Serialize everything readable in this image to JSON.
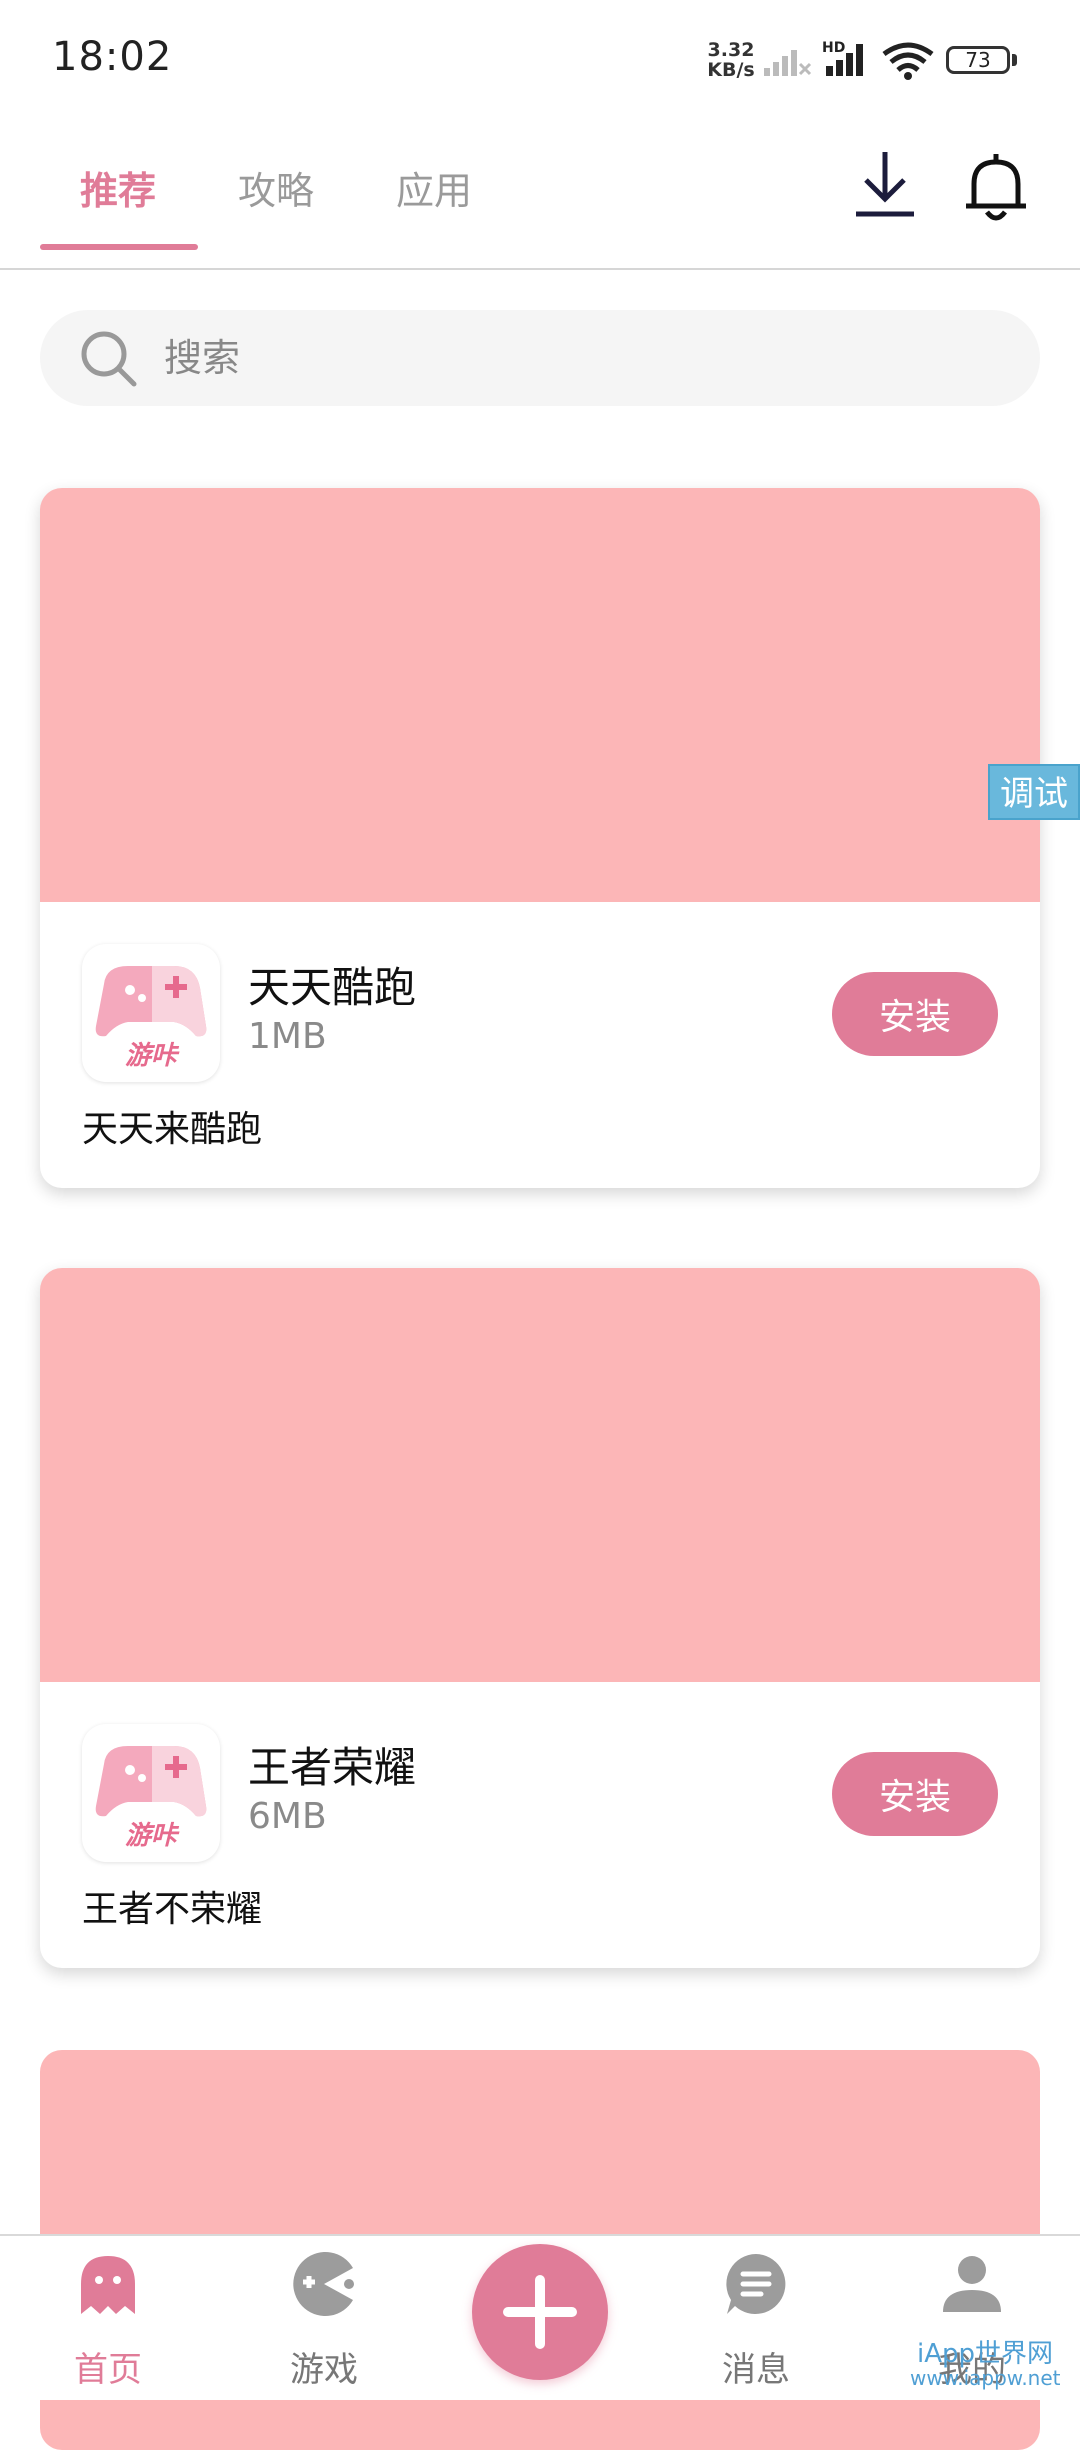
{
  "status_bar": {
    "time": "18:02",
    "net_speed_value": "3.32",
    "net_speed_unit": "KB/s",
    "hd_label": "HD",
    "battery": "73"
  },
  "top_tabs": [
    {
      "label": "推荐",
      "active": true
    },
    {
      "label": "攻略",
      "active": false
    },
    {
      "label": "应用",
      "active": false
    }
  ],
  "header_icons": [
    "download-icon",
    "bell-icon"
  ],
  "search": {
    "placeholder": "搜索",
    "value": ""
  },
  "debug_tag": "调试",
  "cards": [
    {
      "name": "天天酷跑",
      "size": "1MB",
      "description": "天天来酷跑",
      "install_label": "安装",
      "icon_text": "游咔"
    },
    {
      "name": "王者荣耀",
      "size": "6MB",
      "description": "王者不荣耀",
      "install_label": "安装",
      "icon_text": "游咔"
    }
  ],
  "bottom_nav": [
    {
      "label": "首页",
      "icon": "ghost-icon",
      "active": true
    },
    {
      "label": "游戏",
      "icon": "gamepad-icon",
      "active": false
    },
    {
      "label": "",
      "icon": "plus-icon",
      "active": false
    },
    {
      "label": "消息",
      "icon": "message-icon",
      "active": false
    },
    {
      "label": "我的",
      "icon": "person-icon",
      "active": false
    }
  ],
  "watermark": {
    "line1": "iApp世界网",
    "line2": "www.iappw.net"
  },
  "colors": {
    "accent": "#e07c98",
    "banner": "#fcb6b7",
    "debug": "#69b8dc"
  }
}
